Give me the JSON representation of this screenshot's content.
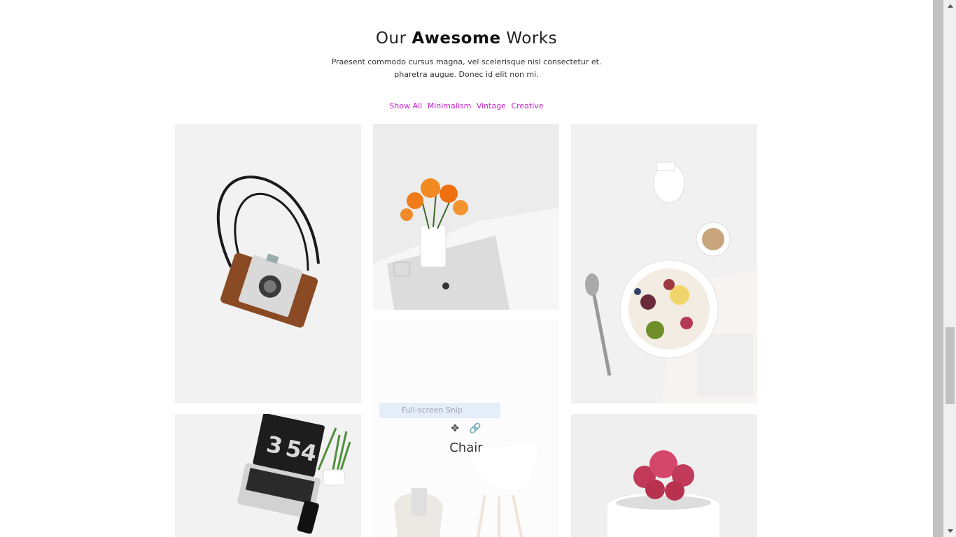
{
  "section": {
    "title_pre": "Our",
    "title_bold": "Awesome",
    "title_post": "Works",
    "subtitle_line1": "Praesent commodo cursus magna, vel scelerisque nisl consectetur et.",
    "subtitle_line2": "pharetra augue. Donec id elit non mi."
  },
  "filters": [
    "Show All",
    "Minimalism",
    "Vintage",
    "Creative"
  ],
  "colors": {
    "filter_link": "#c222c9",
    "title": "#222222"
  },
  "overlay": {
    "title": "Chair",
    "move_icon": "move-icon",
    "link_icon": "link-icon",
    "snip_label": "Full-screen Snip"
  },
  "portfolio_items": [
    {
      "subject": "vintage camera",
      "icon": "camera-image"
    },
    {
      "subject": "orange lilies in vase",
      "icon": "flowers-image"
    },
    {
      "subject": "breakfast bowl with coffee",
      "icon": "breakfast-image"
    },
    {
      "subject": "laptop with clock",
      "icon": "laptop-image"
    },
    {
      "subject": "chair",
      "icon": "chair-image"
    },
    {
      "subject": "pink cactus",
      "icon": "cactus-image"
    }
  ]
}
